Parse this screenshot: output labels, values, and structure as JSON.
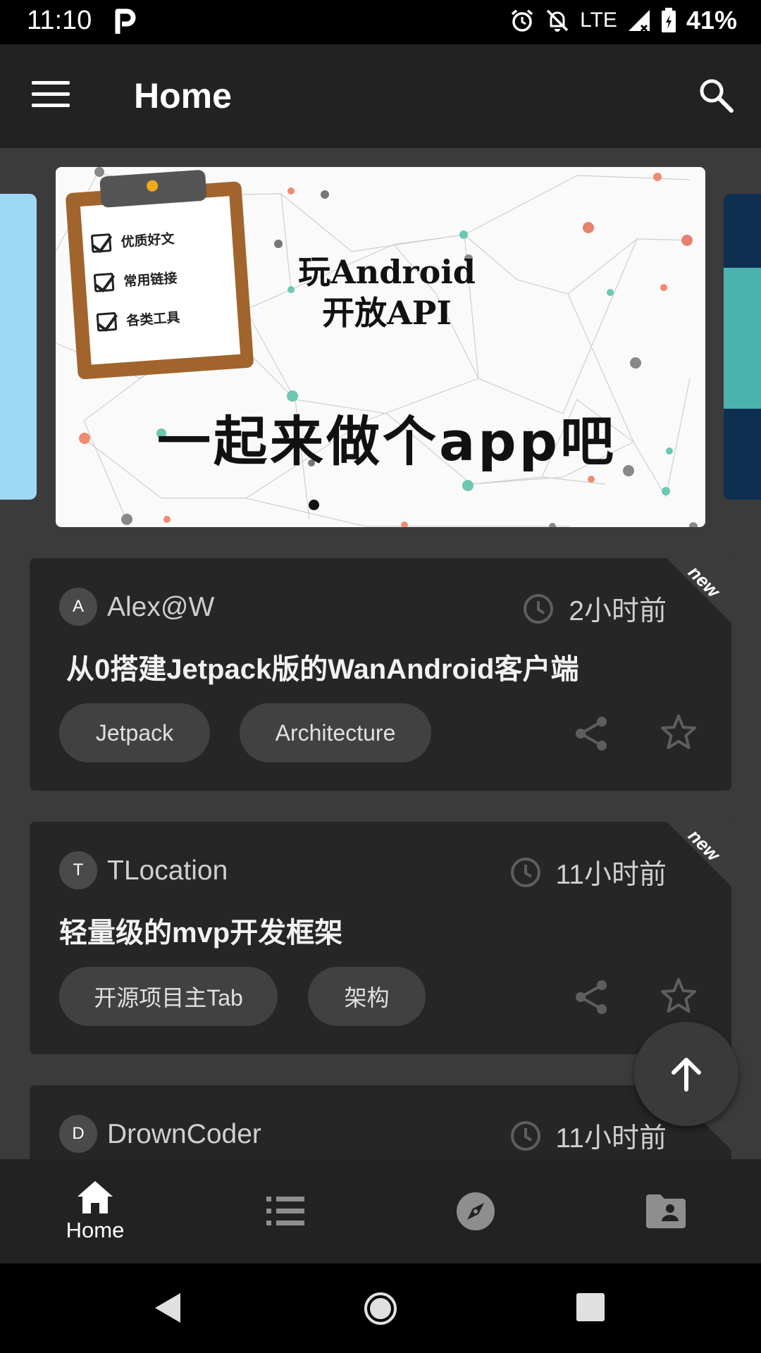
{
  "status_bar": {
    "time": "11:10",
    "network": "LTE",
    "battery": "41%"
  },
  "app_bar": {
    "title": "Home"
  },
  "banner": {
    "checklist": [
      "优质好文",
      "常用链接",
      "各类工具"
    ],
    "title_line1": "玩Android",
    "title_line2": "开放API",
    "slogan": "一起来做个app吧"
  },
  "articles": [
    {
      "avatar_letter": "A",
      "author": "Alex@W",
      "time": "2小时前",
      "title": "从0搭建Jetpack版的WanAndroid客户端",
      "tags": [
        "Jetpack",
        "Architecture"
      ],
      "badge": "new"
    },
    {
      "avatar_letter": "T",
      "author": "TLocation",
      "time": "11小时前",
      "title": "轻量级的mvp开发框架",
      "tags": [
        "开源项目主Tab",
        "架构"
      ],
      "badge": "new"
    },
    {
      "avatar_letter": "D",
      "author": "DrownCoder",
      "time": "11小时前"
    }
  ],
  "bottom_nav": {
    "home_label": "Home",
    "items": [
      "home-icon",
      "list-icon",
      "compass-icon",
      "contact-folder-icon"
    ]
  },
  "colors": {
    "app_bar": "#222222",
    "background": "#3b3b3b",
    "card": "#262626",
    "chip": "#414141"
  }
}
